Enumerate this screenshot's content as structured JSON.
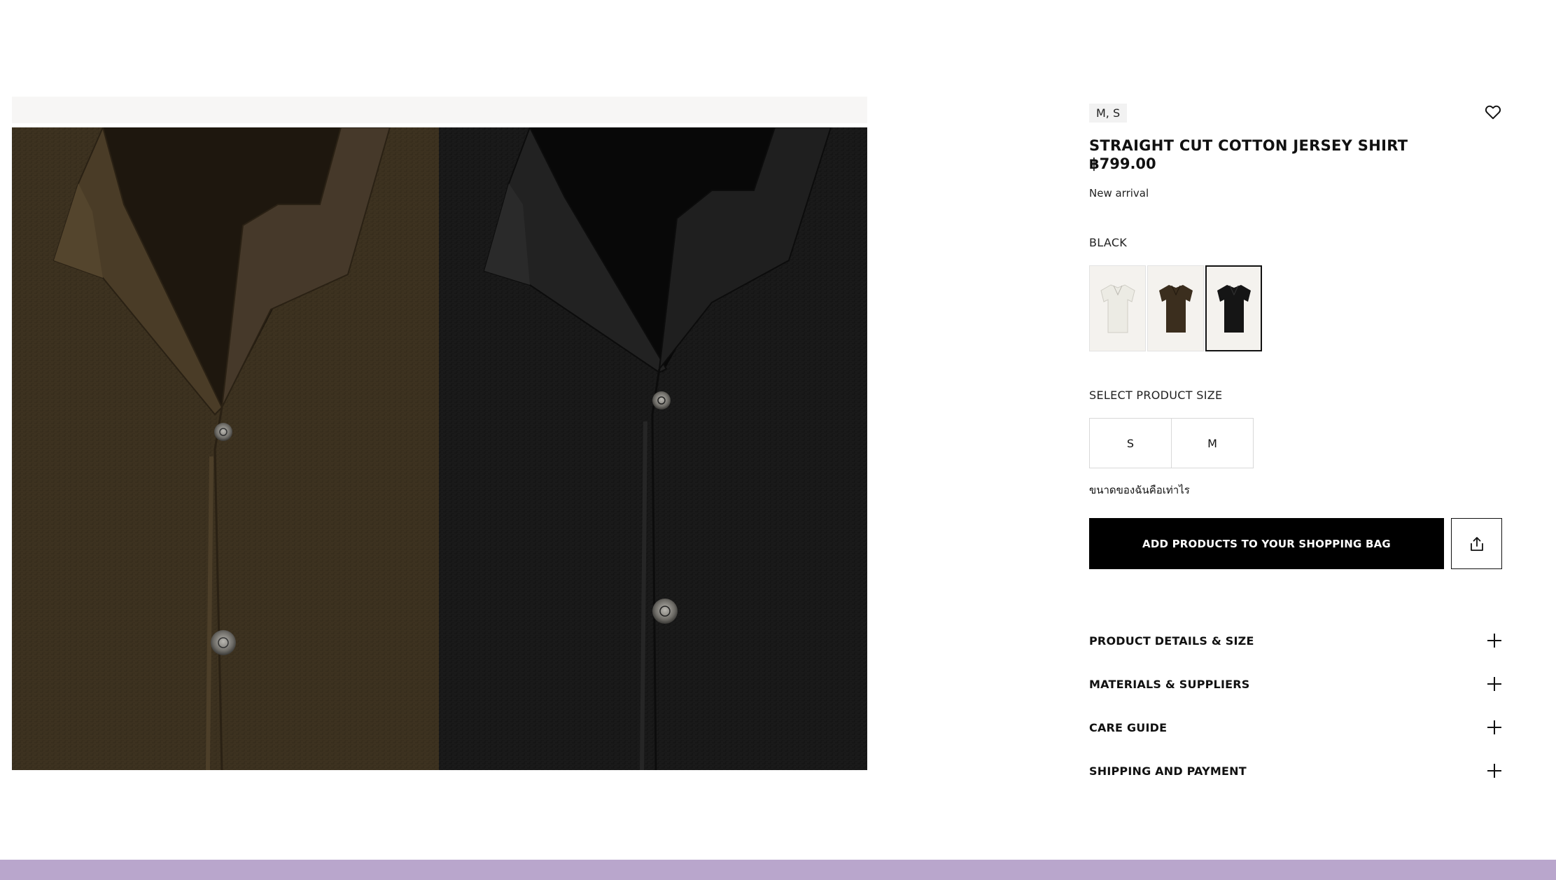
{
  "product": {
    "available_sizes_tag": "M, S",
    "title": "STRAIGHT CUT COTTON JERSEY SHIRT",
    "price": "฿799.00",
    "badge": "New arrival"
  },
  "color": {
    "selected_label": "BLACK",
    "swatches": [
      {
        "name": "white",
        "hex": "#ecebe4"
      },
      {
        "name": "brown",
        "hex": "#3b2e1e"
      },
      {
        "name": "black",
        "hex": "#151515"
      }
    ],
    "selected_index": 2
  },
  "size": {
    "label": "SELECT PRODUCT SIZE",
    "options": [
      "S",
      "M"
    ],
    "guide_link": "ขนาดของฉันคือเท่าไร"
  },
  "actions": {
    "add_to_bag": "ADD PRODUCTS TO YOUR SHOPPING BAG",
    "share_icon": "share-icon",
    "favorite_icon": "heart-icon"
  },
  "accordion": [
    {
      "label": "PRODUCT DETAILS & SIZE"
    },
    {
      "label": "MATERIALS & SUPPLIERS"
    },
    {
      "label": "CARE GUIDE"
    },
    {
      "label": "SHIPPING AND PAYMENT"
    }
  ],
  "colors": {
    "accent_footer": "#b9a6cc",
    "button_bg": "#000000"
  }
}
